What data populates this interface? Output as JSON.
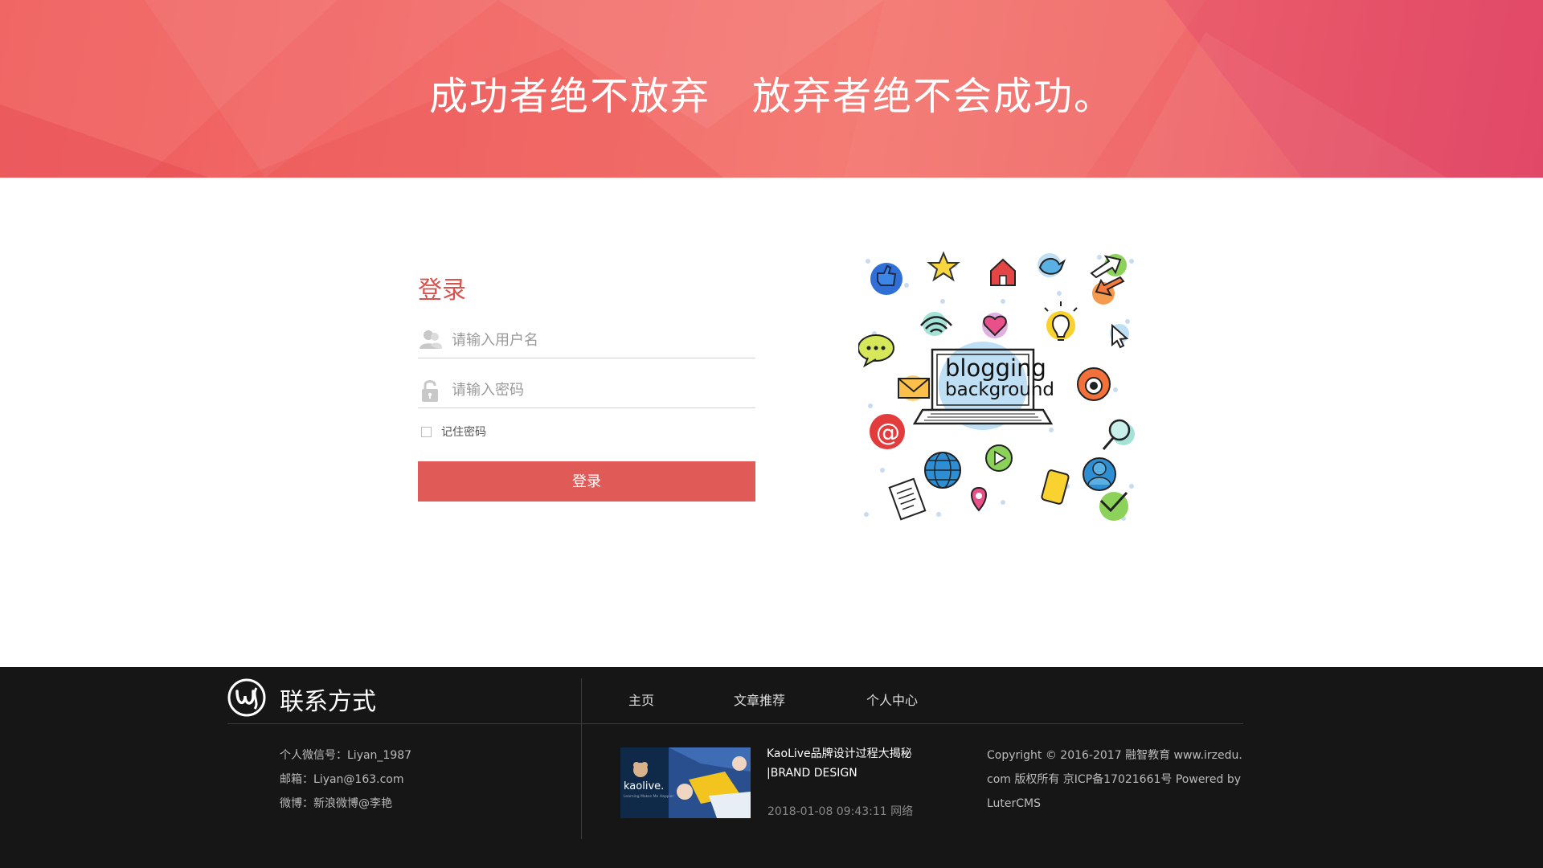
{
  "banner": {
    "slogan_part1": "成功者绝不放弃",
    "slogan_part2": "放弃者绝不会成功。"
  },
  "login": {
    "title": "登录",
    "username_placeholder": "请输入用户名",
    "password_placeholder": "请输入密码",
    "remember_label": "记住密码",
    "remember_checked": false,
    "submit_label": "登录"
  },
  "illustration": {
    "line1": "blogging",
    "line2": "background"
  },
  "footer": {
    "contact_title": "联系方式",
    "wechat": "个人微信号：Liyan_1987",
    "email": "邮箱：Liyan@163.com",
    "weibo": "微博：新浪微博@李艳",
    "nav": [
      "主页",
      "文章推荐",
      "个人中心"
    ],
    "news": {
      "title": "KaoLive品牌设计过程大揭秘 |BRAND DESIGN",
      "meta": "2018-01-08 09:43:11 网络",
      "thumb_brand": "kaolive.",
      "thumb_tagline": "Learning Makes Me Happier"
    },
    "copyright": "Copyright © 2016-2017 融智教育 www.irzedu.com 版权所有 京ICP备17021661号 Powered by LuterCMS"
  },
  "colors": {
    "accent": "#e05a58",
    "banner_red": "#ef5a5a",
    "footer_bg": "#161616"
  }
}
